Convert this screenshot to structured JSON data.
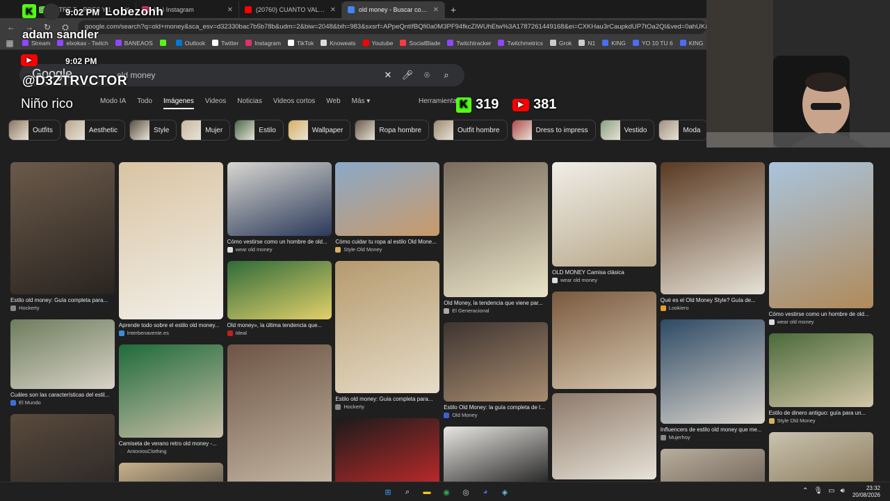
{
  "browser": {
    "tabs": [
      {
        "title": "ENTRE T... RDES Y 1 MENT",
        "color": "#53fc18",
        "active": false
      },
      {
        "title": "(9+) Instagram",
        "color": "#e1306c",
        "active": false
      },
      {
        "title": "(20760) CUANTO VALE TU OUTFIT",
        "color": "#ff0000",
        "active": false
      },
      {
        "title": "old money - Buscar con Google",
        "color": "#4285f4",
        "active": true
      }
    ],
    "new_tab": "+",
    "url": "google.com/search?q=old+money&sca_esv=d32330bac7b5b78b&udm=2&biw=2048&bih=983&sxsrf=APpeQntIfBQfi0a0M3PF94fkcZIWUhEtw%3A1787261449168&ei=CXKHau3rCaupkdUP7tOa2QI&ved=0ahUKEwitlLHek7CWAxWrVKQEH",
    "bookmarks": [
      {
        "label": "Stream",
        "color": "#9146ff"
      },
      {
        "label": "elxokas - Twitch",
        "color": "#9146ff"
      },
      {
        "label": "BANEAOS",
        "color": "#9146ff"
      },
      {
        "label": "",
        "color": "#53fc18"
      },
      {
        "label": "Outlook",
        "color": "#0078d4"
      },
      {
        "label": "Twitter",
        "color": "#ffffff"
      },
      {
        "label": "Instagram",
        "color": "#e1306c"
      },
      {
        "label": "TikTok",
        "color": "#ffffff"
      },
      {
        "label": "Knoweats",
        "color": "#dddddd"
      },
      {
        "label": "Youtube",
        "color": "#ff0000"
      },
      {
        "label": "SocialBlade",
        "color": "#ff3b3b"
      },
      {
        "label": "Twitchtracker",
        "color": "#9146ff"
      },
      {
        "label": "Twitchmetrics",
        "color": "#9146ff"
      },
      {
        "label": "Grok",
        "color": "#cccccc"
      },
      {
        "label": "N1",
        "color": "#cccccc"
      },
      {
        "label": "KING",
        "color": "#4a6cf7"
      },
      {
        "label": "YO 10 TU 6",
        "color": "#4a6cf7"
      },
      {
        "label": "KING",
        "color": "#4a6cf7"
      }
    ]
  },
  "google": {
    "logo": "Google",
    "query": "old money",
    "nav": [
      "Modo IA",
      "Todo",
      "Imágenes",
      "Videos",
      "Noticias",
      "Videos cortos",
      "Web",
      "Más ▾"
    ],
    "nav_active": "Imágenes",
    "tools": "Herramientas",
    "chips": [
      "Outfits",
      "Aesthetic",
      "Style",
      "Mujer",
      "Estilo",
      "Wallpaper",
      "Ropa hombre",
      "Outfit hombre",
      "Dress to impress",
      "Vestido",
      "Moda"
    ],
    "results": [
      [
        {
          "h": 190,
          "c1": "#6b5a4a",
          "c2": "#2a2420",
          "cap": "Estilo old money: Guía completa para...",
          "src": "Hockerty",
          "sc": "#888"
        },
        {
          "h": 100,
          "c1": "#6e7d5c",
          "c2": "#d8d3c8",
          "cap": "Cuáles son las características del estil...",
          "src": "El Mundo",
          "sc": "#3b6fd8"
        },
        {
          "h": 100,
          "c1": "#5a4a3c",
          "c2": "#2e2a28",
          "cap": "",
          "src": "",
          "sc": "#888"
        }
      ],
      [
        {
          "h": 226,
          "c1": "#d9c4a3",
          "c2": "#f2efe8",
          "cap": "Aprende todo sobre el estilo old money...",
          "src": "Interbenavente.es",
          "sc": "#3b8fd8"
        },
        {
          "h": 134,
          "c1": "#1f6b3a",
          "c2": "#c9bfa8",
          "cap": "Camiseta de verano retro old money -...",
          "src": "AntoniosClothing",
          "sc": "#222"
        },
        {
          "h": 80,
          "c1": "#c9b08a",
          "c2": "#3a3a3a",
          "cap": "",
          "src": "",
          "sc": "#888"
        }
      ],
      [
        {
          "h": 106,
          "c1": "#d8d6d0",
          "c2": "#2b3a5a",
          "cap": "Cómo vestirse como un hombre de old...",
          "src": "wear old money",
          "sc": "#ddd"
        },
        {
          "h": 84,
          "c1": "#2f6b3a",
          "c2": "#e2d06a",
          "cap": "Old money», la última tendencia que...",
          "src": "Ideal",
          "sc": "#c02020"
        },
        {
          "h": 210,
          "c1": "#6e5546",
          "c2": "#c7b9a6",
          "cap": "",
          "src": "",
          "sc": "#888"
        }
      ],
      [
        {
          "h": 106,
          "c1": "#8aa9c9",
          "c2": "#c99a6a",
          "cap": "Cómo cuidar tu ropa al estilo Old Mone...",
          "src": "Style Old Money",
          "sc": "#d8b060"
        },
        {
          "h": 190,
          "c1": "#b59a6e",
          "c2": "#e6dcc8",
          "cap": "Estilo old money: Guía completa para...",
          "src": "Hockerty",
          "sc": "#888"
        },
        {
          "h": 100,
          "c1": "#1b1b1b",
          "c2": "#c02a2a",
          "cap": "",
          "src": "",
          "sc": "#888"
        }
      ],
      [
        {
          "h": 194,
          "c1": "#7a6b5c",
          "c2": "#e9e4c8",
          "cap": "Old Money, la tendencia que viene par...",
          "src": "El Generacional",
          "sc": "#aaa"
        },
        {
          "h": 114,
          "c1": "#3e3430",
          "c2": "#a88c70",
          "cap": "Estilo Old Money: la guía completa de l...",
          "src": "Old Money",
          "sc": "#3b5fd8"
        },
        {
          "h": 90,
          "c1": "#e8e6e2",
          "c2": "#1b1b1b",
          "cap": "",
          "src": "",
          "sc": "#888"
        }
      ],
      [
        {
          "h": 150,
          "c1": "#f0eee8",
          "c2": "#b8a88a",
          "cap": "OLD MONEY Camisa clásica",
          "src": "wear old money",
          "sc": "#ddd"
        },
        {
          "h": 140,
          "c1": "#7a5a3e",
          "c2": "#d6c6ae",
          "cap": "",
          "src": "",
          "sc": "#888"
        },
        {
          "h": 124,
          "c1": "#8d7a6a",
          "c2": "#e8e2d8",
          "cap": "",
          "src": "",
          "sc": "#888"
        }
      ],
      [
        {
          "h": 190,
          "c1": "#5a3a22",
          "c2": "#e6e1d6",
          "cap": "Qué es el Old Money Style? Guía de...",
          "src": "Lookiero",
          "sc": "#e8a020"
        },
        {
          "h": 150,
          "c1": "#2e4a66",
          "c2": "#d9d4cc",
          "cap": "Influencers de estilo old money que me...",
          "src": "Mujerhoy",
          "sc": "#888"
        },
        {
          "h": 70,
          "c1": "#b8ae9e",
          "c2": "#6a5e50",
          "cap": "",
          "src": "",
          "sc": "#888"
        }
      ],
      [
        {
          "h": 210,
          "c1": "#a9c4dd",
          "c2": "#b08a5a",
          "cap": "Cómo vestirse como un hombre de old...",
          "src": "wear old money",
          "sc": "#ddd"
        },
        {
          "h": 106,
          "c1": "#4a6a3a",
          "c2": "#d4c6a8",
          "cap": "Estilo de dinero antiguo: guía para un...",
          "src": "Style Old Money",
          "sc": "#d8b060"
        },
        {
          "h": 80,
          "c1": "#c9c2b0",
          "c2": "#8a7a5a",
          "cap": "",
          "src": "",
          "sc": "#888"
        }
      ]
    ]
  },
  "overlay": {
    "top_time": "9:02 PM",
    "streamer": "Lobezohh",
    "small_tag": "In",
    "alert_name": "adam sandler",
    "yt_time": "9:02 PM",
    "handle": "@D3ZTRVCTOR",
    "nickname": "Niño rico",
    "kick_count": "319",
    "yt_count": "381",
    "kick_letter": "K"
  },
  "taskbar": {
    "time": "23:32",
    "date": "20/08/2026",
    "apps": [
      {
        "name": "windows-start",
        "glyph": "⊞",
        "color": "#3aa0ff"
      },
      {
        "name": "search",
        "glyph": "⌕",
        "color": "#e8eaed"
      },
      {
        "name": "file-explorer",
        "glyph": "▬",
        "color": "#f4c430"
      },
      {
        "name": "chrome",
        "glyph": "◉",
        "color": "#34a853"
      },
      {
        "name": "obs",
        "glyph": "◎",
        "color": "#cccccc"
      },
      {
        "name": "discord",
        "glyph": "◕",
        "color": "#5865f2"
      },
      {
        "name": "steam",
        "glyph": "◈",
        "color": "#66c0f4"
      }
    ]
  }
}
